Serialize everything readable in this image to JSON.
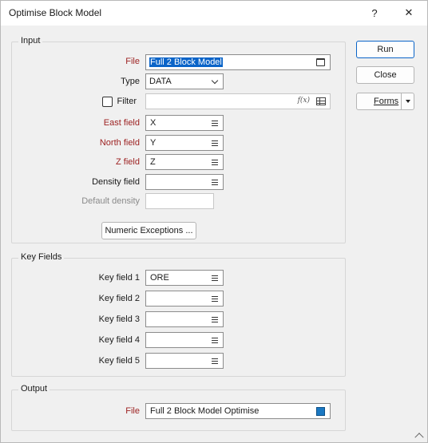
{
  "window": {
    "title": "Optimise Block Model",
    "help_glyph": "?",
    "close_glyph": "✕"
  },
  "input": {
    "legend": "Input",
    "file_label": "File",
    "file_value": "Full 2  Block Model",
    "type_label": "Type",
    "type_value": "DATA",
    "filter_label": "Filter",
    "filter_checked": false,
    "filter_value": "",
    "fx_glyph": "f(x)",
    "east_label": "East field",
    "east_value": "X",
    "north_label": "North field",
    "north_value": "Y",
    "z_label": "Z field",
    "z_value": "Z",
    "density_label": "Density field",
    "density_value": "",
    "default_density_label": "Default density",
    "default_density_value": "",
    "numeric_exceptions_label": "Numeric Exceptions ..."
  },
  "key_fields": {
    "legend": "Key Fields",
    "items": [
      {
        "label": "Key field 1",
        "value": "ORE"
      },
      {
        "label": "Key field 2",
        "value": ""
      },
      {
        "label": "Key field 3",
        "value": ""
      },
      {
        "label": "Key field 4",
        "value": ""
      },
      {
        "label": "Key field 5",
        "value": ""
      }
    ]
  },
  "output": {
    "legend": "Output",
    "file_label": "File",
    "file_value": "Full 2  Block Model Optimise"
  },
  "actions": {
    "run_label": "Run",
    "close_label": "Close",
    "forms_label": "Forms"
  },
  "colors": {
    "required_label": "#9c1f1f",
    "accent": "#0a64c8",
    "output_icon": "#1a78c2"
  }
}
